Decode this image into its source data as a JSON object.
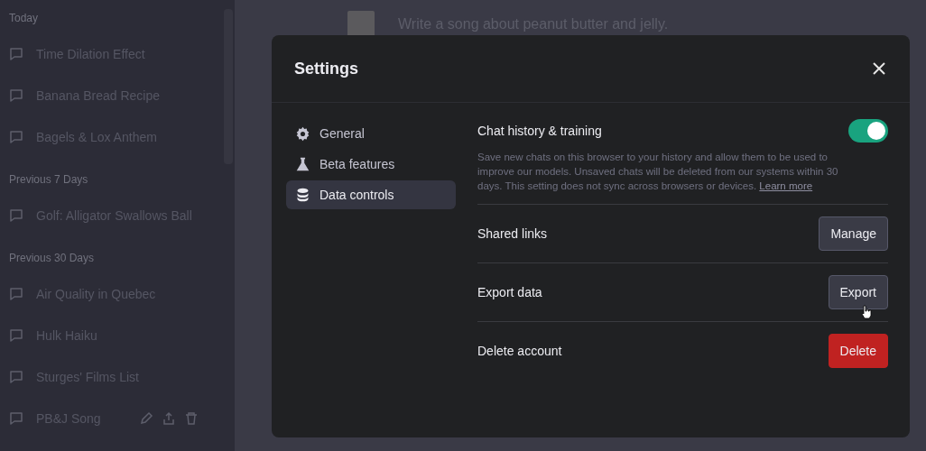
{
  "sidebar": {
    "sections": [
      {
        "heading": "Today",
        "items": [
          {
            "title": "Time Dilation Effect",
            "show_actions": false
          },
          {
            "title": "Banana Bread Recipe",
            "show_actions": false
          },
          {
            "title": "Bagels & Lox Anthem",
            "show_actions": false
          }
        ]
      },
      {
        "heading": "Previous 7 Days",
        "items": [
          {
            "title": "Golf: Alligator Swallows Ball",
            "show_actions": false
          }
        ]
      },
      {
        "heading": "Previous 30 Days",
        "items": [
          {
            "title": "Air Quality in Quebec",
            "show_actions": false
          },
          {
            "title": "Hulk Haiku",
            "show_actions": false
          },
          {
            "title": "Sturges' Films List",
            "show_actions": false
          },
          {
            "title": "PB&J Song",
            "show_actions": true
          }
        ]
      }
    ]
  },
  "chat": {
    "prompt": "Write a song about peanut butter and jelly."
  },
  "settings": {
    "title": "Settings",
    "nav": [
      {
        "label": "General",
        "kind": "general",
        "selected": false
      },
      {
        "label": "Beta features",
        "kind": "beta",
        "selected": false
      },
      {
        "label": "Data controls",
        "kind": "data",
        "selected": true
      }
    ],
    "history": {
      "label": "Chat history & training",
      "on": true,
      "description": "Save new chats on this browser to your history and allow them to be used to improve our models. Unsaved chats will be deleted from our systems within 30 days. This setting does not sync across browsers or devices.",
      "link": "Learn more"
    },
    "rows": [
      {
        "label": "Shared links",
        "button": "Manage",
        "kind": "default",
        "hovered": false
      },
      {
        "label": "Export data",
        "button": "Export",
        "kind": "default",
        "hovered": true
      },
      {
        "label": "Delete account",
        "button": "Delete",
        "kind": "danger",
        "hovered": false
      }
    ]
  }
}
